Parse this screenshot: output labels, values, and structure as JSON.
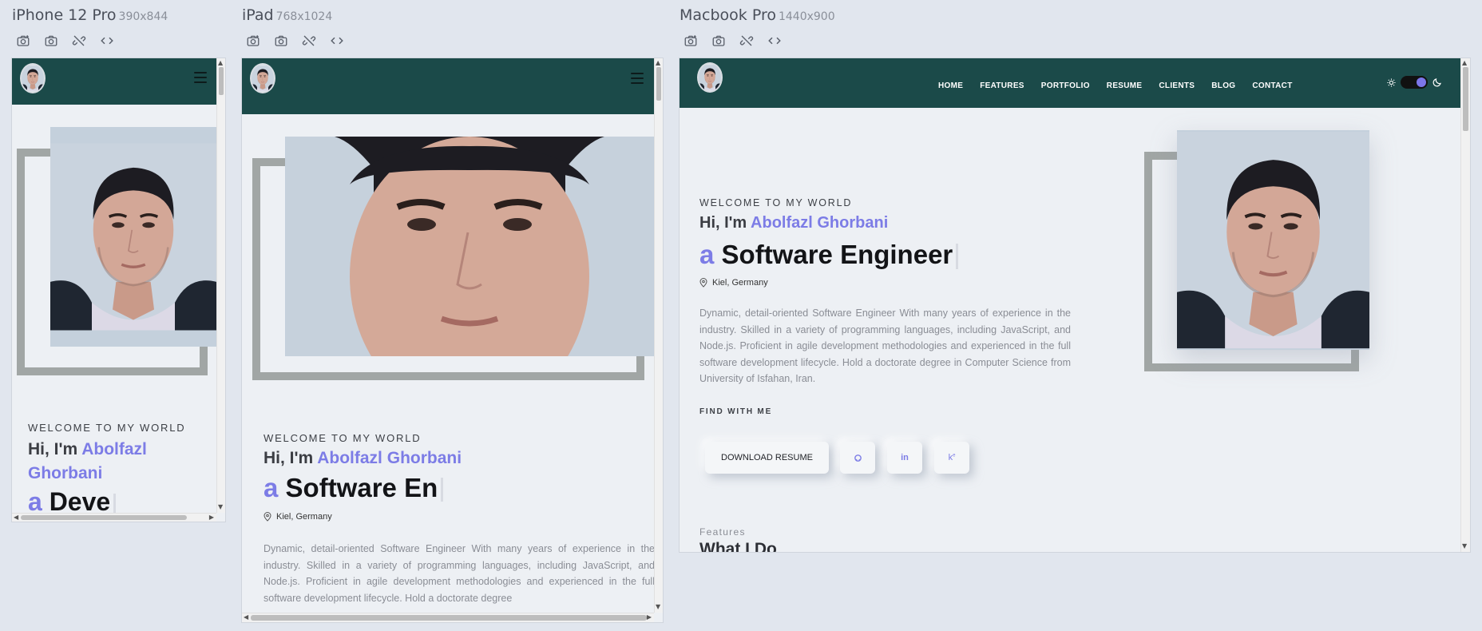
{
  "devices": [
    {
      "name": "iPhone 12 Pro",
      "size": "390x844"
    },
    {
      "name": "iPad",
      "size": "768x1024"
    },
    {
      "name": "Macbook Pro",
      "size": "1440x900"
    }
  ],
  "toolbar_icons": [
    "camera-capture-icon",
    "camera-icon",
    "link-off-icon",
    "code-icon"
  ],
  "site": {
    "nav": [
      "HOME",
      "FEATURES",
      "PORTFOLIO",
      "RESUME",
      "CLIENTS",
      "BLOG",
      "CONTACT"
    ],
    "welcome": "WELCOME TO MY WORLD",
    "greeting": "Hi, I'm ",
    "name": "Abolfazl Ghorbani",
    "name_first": "Abolfazl",
    "name_last": "Ghorbani",
    "article": "a",
    "role_full": "Software Engineer",
    "role_ipad": "Software En",
    "role_phone": "Deve",
    "location": "Kiel, Germany",
    "bio": "Dynamic, detail-oriented Software Engineer With many years of experience in the industry. Skilled in a variety of programming languages, including JavaScript, and Node.js. Proficient in agile development methodologies and experienced in the full software development lifecycle. Hold a doctorate degree in Computer Science from University of Isfahan, Iran.",
    "bio_ipad": "Dynamic, detail-oriented Software Engineer With many years of experience in the industry. Skilled in a variety of programming languages, including JavaScript, and Node.js. Proficient in agile development methodologies and experienced in the full software development lifecycle. Hold a doctorate degree",
    "find_with_me": "FIND WITH ME",
    "download_resume": "DOWNLOAD RESUME",
    "social": [
      "github-icon",
      "linkedin-icon",
      "kaggle-icon"
    ],
    "linkedin_text": "in",
    "kaggle_text": "k",
    "features_label": "Features",
    "features_title": "What I Do"
  },
  "colors": {
    "navbar": "#1b4a49",
    "accent": "#7c7ce6",
    "page_bg": "#edf0f4",
    "outer_bg": "#e1e6ee",
    "frame_border": "#a1a6a5"
  }
}
